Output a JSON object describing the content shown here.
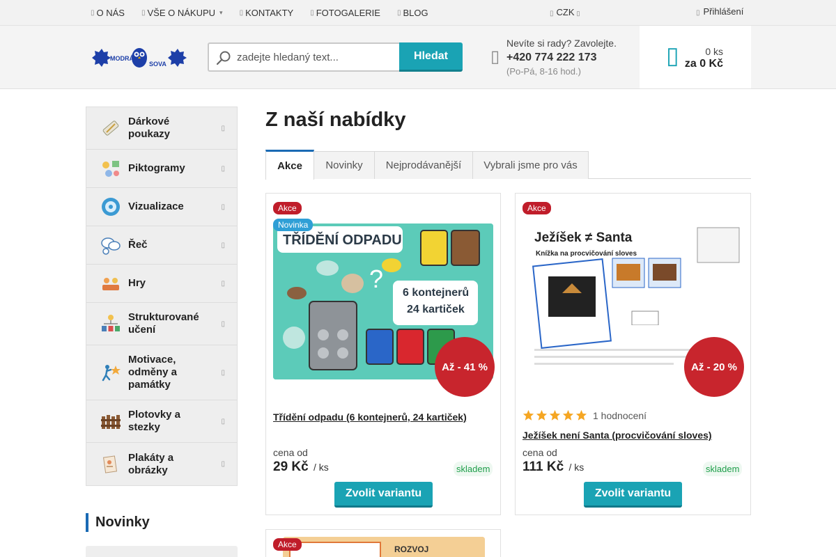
{
  "topnav": {
    "items": [
      {
        "label": "O NÁS"
      },
      {
        "label": "VŠE O NÁKUPU"
      },
      {
        "label": "KONTAKTY"
      },
      {
        "label": "FOTOGALERIE"
      },
      {
        "label": "BLOG"
      }
    ],
    "currency": "CZK",
    "login": "Přihlášení"
  },
  "header": {
    "logo_text_left": "MODRÁ",
    "logo_text_right": "SOVA",
    "search_placeholder": "zadejte hledaný text...",
    "search_button": "Hledat",
    "help_question": "Nevíte si rady? Zavolejte.",
    "phone": "+420 774 222 173",
    "hours": "(Po-Pá, 8-16 hod.)",
    "cart_qty": "0 ks",
    "cart_total": "za 0 Kč"
  },
  "sidebar": {
    "categories": [
      {
        "label": "Dárkové poukazy",
        "icon": "gift-voucher-icon"
      },
      {
        "label": "Piktogramy",
        "icon": "pictogram-icon"
      },
      {
        "label": "Vizualizace",
        "icon": "visualization-icon"
      },
      {
        "label": "Řeč",
        "icon": "speech-bubbles-icon"
      },
      {
        "label": "Hry",
        "icon": "games-icon"
      },
      {
        "label": "Strukturované učení",
        "icon": "structured-learning-icon"
      },
      {
        "label": "Motivace, odměny a památky",
        "icon": "motivation-icon"
      },
      {
        "label": "Plotovky a stezky",
        "icon": "fence-icon"
      },
      {
        "label": "Plakáty a obrázky",
        "icon": "poster-icon"
      }
    ],
    "news_heading": "Novinky"
  },
  "main": {
    "title": "Z naší nabídky",
    "tabs": [
      {
        "label": "Akce"
      },
      {
        "label": "Novinky"
      },
      {
        "label": "Nejprodávanější"
      },
      {
        "label": "Vybrali jsme pro vás"
      }
    ],
    "products": [
      {
        "badge_sale": "Akce",
        "badge_new": "Novinka",
        "image_title": "TŘÍDĚNÍ ODPADU",
        "image_sub1": "6 kontejnerů",
        "image_sub2": "24 kartiček",
        "discount": "Až - 41 %",
        "name": "Třídění odpadu (6 kontejnerů, 24 kartiček)",
        "price_label": "cena od",
        "price": "29 Kč",
        "unit": "/ ks",
        "stock": "skladem",
        "button": "Zvolit variantu"
      },
      {
        "badge_sale": "Akce",
        "image_title": "Ježíšek ≠ Santa",
        "image_sub": "Knížka na procvičování sloves",
        "discount": "Až - 20 %",
        "rating": 5,
        "rating_count": "1 hodnocení",
        "name": "Ježíšek není Santa (procvičování sloves)",
        "price_label": "cena od",
        "price": "111 Kč",
        "unit": "/ ks",
        "stock": "skladem",
        "button": "Zvolit variantu"
      },
      {
        "badge_sale": "Akce",
        "image_title": "ROZVOJ"
      }
    ]
  },
  "colors": {
    "accent": "#1aa3b4",
    "sale": "#c01d2a",
    "new": "#2f9fd6",
    "stock": "#1e9e4a",
    "star": "#f5a623"
  }
}
